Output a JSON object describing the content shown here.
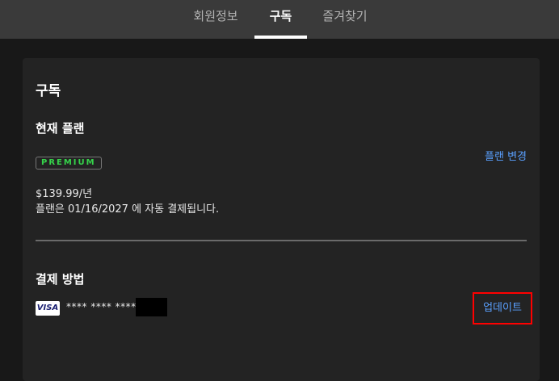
{
  "nav": {
    "tabs": [
      {
        "label": "회원정보",
        "active": false
      },
      {
        "label": "구독",
        "active": true
      },
      {
        "label": "즐겨찾기",
        "active": false
      }
    ]
  },
  "subscription": {
    "title": "구독",
    "current_plan": {
      "heading": "현재 플랜",
      "badge": "PREMIUM",
      "change_link": "플랜 변경",
      "price": "$139.99/년",
      "renewal_text": "플랜은 01/16/2027 에 자동 결제됩니다."
    },
    "payment": {
      "heading": "결제 방법",
      "card_brand": "VISA",
      "masked_number": "**** **** ****",
      "update_label": "업데이트"
    }
  },
  "colors": {
    "background": "#181818",
    "nav_background": "#3a3a3a",
    "card_background": "#232323",
    "link": "#5aa0ff",
    "premium_badge": "#35d34a",
    "highlight_border": "#ff0000"
  }
}
